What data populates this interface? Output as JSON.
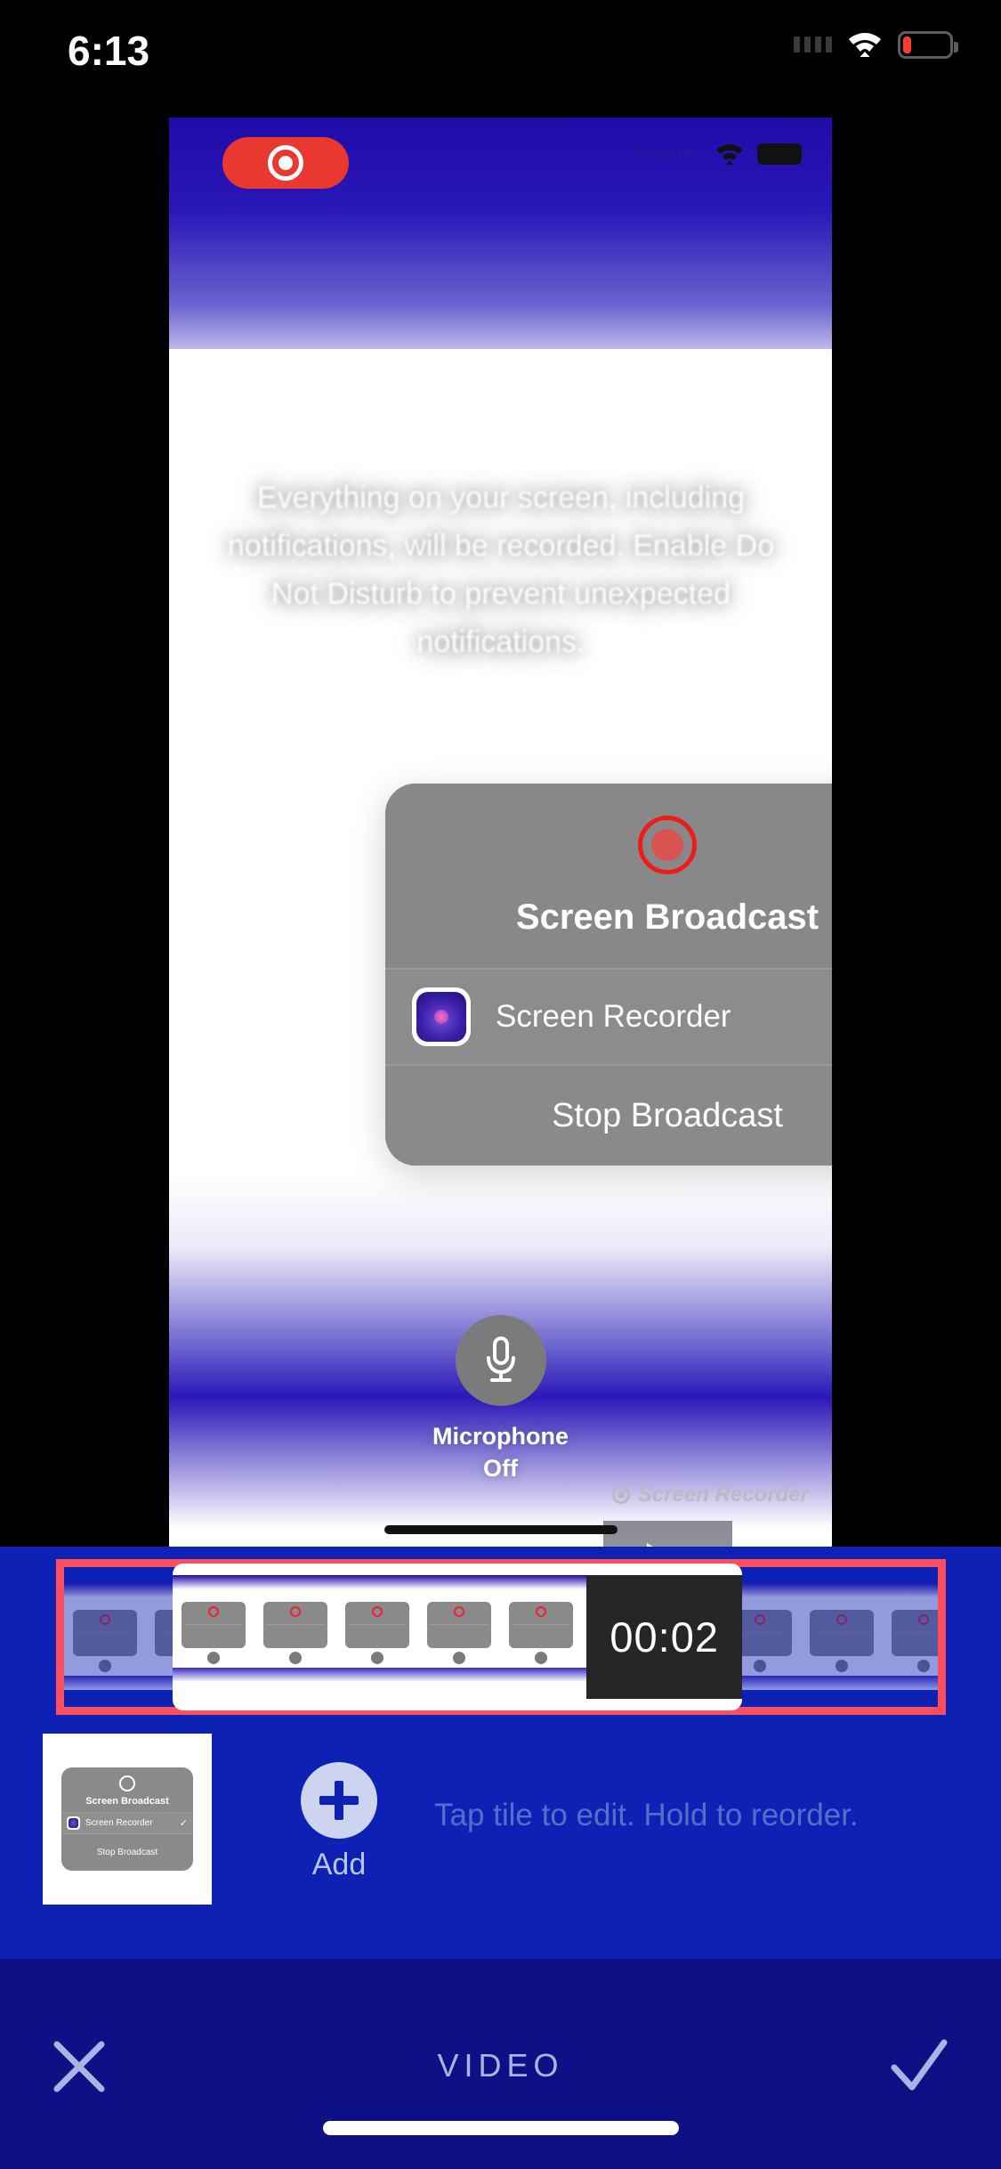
{
  "status_bar": {
    "time": "6:13",
    "wifi_icon": "wifi-icon",
    "battery_icon": "battery-low-icon",
    "signal_icon": "cellular-dots-icon"
  },
  "preview": {
    "recording_badge_icon": "record-dot-icon",
    "mini_status": {
      "carrier": "Screen Rec",
      "wifi_icon": "wifi-icon",
      "battery_icon": "battery-icon"
    },
    "description": "Everything on your screen, including notifications, will be recorded. Enable Do Not Disturb to prevent unexpected notifications.",
    "broadcast_dialog": {
      "record_icon": "record-circle-icon",
      "title": "Screen Broadcast",
      "app_row": {
        "app_icon": "screen-recorder-app-icon",
        "label": "Screen Recorder",
        "status_icon": "loading-spinner-icon"
      },
      "stop_label": "Stop Broadcast"
    },
    "microphone": {
      "icon": "microphone-icon",
      "label": "Microphone",
      "state": "Off"
    },
    "play_button_icon": "play-triangle-icon",
    "watermark": {
      "icon": "record-dot-icon",
      "text": "Screen Recorder"
    }
  },
  "editor": {
    "timeline": {
      "duration_badge": "00:02",
      "selection_border_color": "#ff4f5e",
      "frame_count": 11
    },
    "tiles": {
      "thumbnail": {
        "title": "Screen Broadcast",
        "app_label": "Screen Recorder",
        "check_icon": "checkmark-icon",
        "stop_label": "Stop Broadcast"
      },
      "add_button": {
        "icon": "plus-icon",
        "label": "Add"
      },
      "hint": "Tap tile to edit. Hold to reorder."
    }
  },
  "bottom_bar": {
    "cancel_icon": "close-x-icon",
    "title": "VIDEO",
    "confirm_icon": "checkmark-icon"
  },
  "colors": {
    "editor_blue": "#0d22b5",
    "bottom_blue": "#0d1185",
    "accent_red": "#ff4f5e",
    "record_red": "#e8382f"
  }
}
